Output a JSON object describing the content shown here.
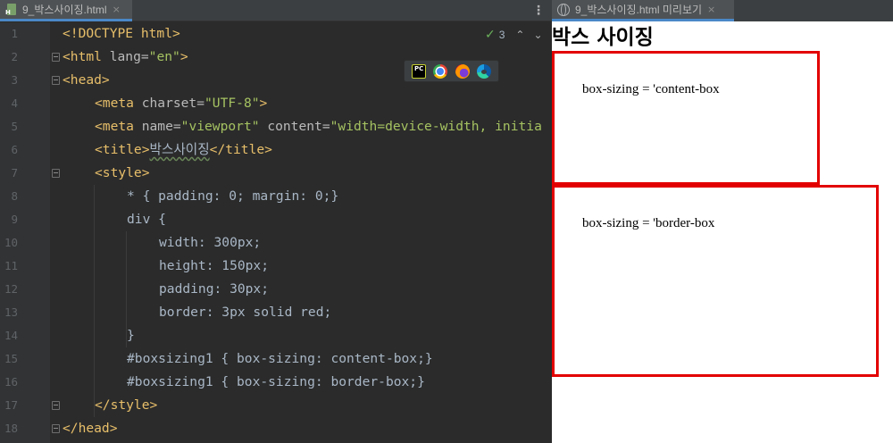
{
  "editor": {
    "tab_label": "9_박스사이징.html",
    "tab_close": "×",
    "menu_glyph": "⋮",
    "inspection": {
      "check": "✓",
      "count": "3",
      "up": "⌃",
      "down": "⌄"
    },
    "browser_icons": [
      "pycharm-icon",
      "chrome-icon",
      "firefox-icon",
      "edge-icon"
    ],
    "pycharm_text": "PC",
    "line_numbers": [
      "1",
      "2",
      "3",
      "4",
      "5",
      "6",
      "7",
      "8",
      "9",
      "10",
      "11",
      "12",
      "13",
      "14",
      "15",
      "16",
      "17",
      "18"
    ],
    "code": {
      "l1": "<!DOCTYPE html>",
      "l2_open": "<html ",
      "l2_attr": "lang=",
      "l2_val": "\"en\"",
      "l2_close": ">",
      "l3": "<head>",
      "l4_open": "<meta ",
      "l4_attr": "charset=",
      "l4_val": "\"UTF-8\"",
      "l4_close": ">",
      "l5_open": "<meta ",
      "l5_attr1": "name=",
      "l5_val1": "\"viewport\"",
      "l5_sp": " ",
      "l5_attr2": "content=",
      "l5_val2": "\"width=device-width, initia",
      "l6_open": "<title>",
      "l6_text": "박스사이징",
      "l6_close": "</title>",
      "l7": "<style>",
      "l8": "* { padding: 0; margin: 0;}",
      "l9": "div {",
      "l10": "width: 300px;",
      "l11": "height: 150px;",
      "l12": "padding: 30px;",
      "l13": "border: 3px solid red;",
      "l14": "}",
      "l15": "#boxsizing1 { box-sizing: content-box;}",
      "l16": "#boxsizing1 { box-sizing: border-box;}",
      "l17": "</style>",
      "l18": "</head>"
    }
  },
  "preview": {
    "tab_label": "9_박스사이징.html 미리보기",
    "tab_close": "×",
    "heading": "박스 사이징",
    "box1_text": "box-sizing = 'content-box",
    "box2_text": "box-sizing = 'border-box",
    "border_color": "#e30000"
  },
  "colors": {
    "editor_bg": "#2b2b2b",
    "tag": "#e8bf6a",
    "attr_value": "#a5c261",
    "accent_tab": "#4a88c7"
  }
}
